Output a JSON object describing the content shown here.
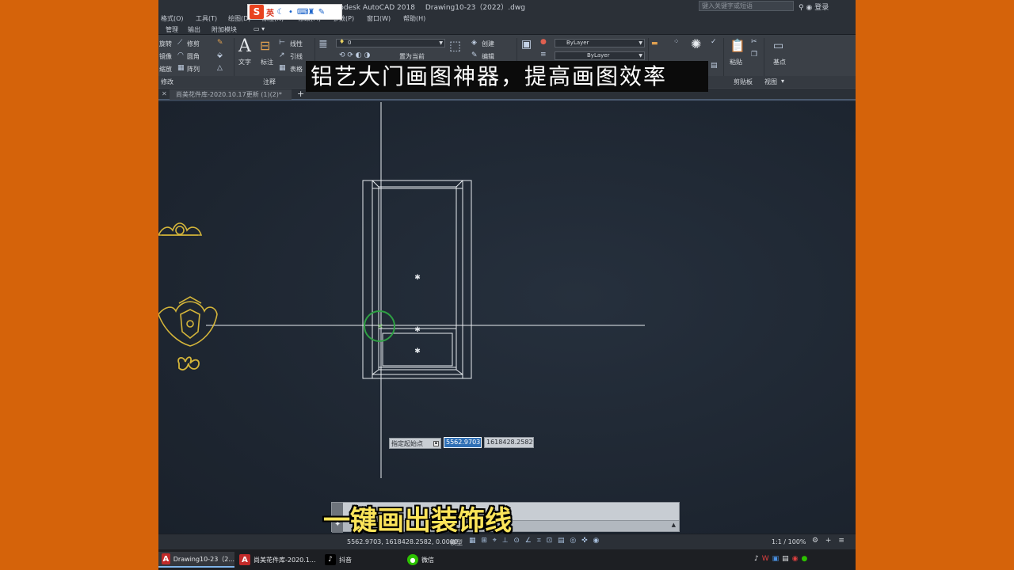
{
  "window": {
    "title_app": "Autodesk AutoCAD 2018",
    "title_file": "Drawing10-23（2022）.dwg",
    "search_placeholder": "键入关键字或短语",
    "user_label": "登录"
  },
  "ime": {
    "logo": "S",
    "mode": "英",
    "icons": [
      "moon-icon",
      "dot-icon",
      "keyboard-icon",
      "shirt-icon",
      "wrench-icon"
    ]
  },
  "menubar": {
    "items": [
      "格式(O)",
      "工具(T)",
      "绘图(D)",
      "标注(N)",
      "修改(M)",
      "参数(P)",
      "窗口(W)",
      "帮助(H)"
    ]
  },
  "ribbon_tabs": {
    "items": [
      "管理",
      "输出",
      "附加模块"
    ]
  },
  "ribbon": {
    "modify": {
      "rotate": "旋转",
      "trim": "修剪",
      "mirror": "镜像",
      "fillet": "圆角",
      "scale": "缩放",
      "array": "阵列",
      "panel": "修改"
    },
    "annotation": {
      "text": "文字",
      "dimension": "标注",
      "linear": "线性",
      "leader": "引线",
      "table": "表格",
      "panel": "注释"
    },
    "layers": {
      "current_layer": "0",
      "set_current": "置为当前"
    },
    "block": {
      "create": "创建",
      "edit": "编辑"
    },
    "properties": {
      "color": "ByLayer",
      "linetype": "ByLayer"
    },
    "clipboard": {
      "paste": "粘贴",
      "panel": "剪贴板"
    },
    "view": {
      "base": "基点",
      "panel": "视图"
    }
  },
  "file_tabs": {
    "active": "尚美花件库-2020.10.17更新 (1)(2)*"
  },
  "dynamic_input": {
    "prompt": "指定起始点",
    "x_value": "5562.9703",
    "y_value": "1618428.2582"
  },
  "status": {
    "coords": "5562.9703, 1618428.2582, 0.0000",
    "model": "模型",
    "scale": "1:1 / 100%"
  },
  "taskbar": {
    "items": [
      {
        "label": "Drawing10-23（2...",
        "icon": "autocad-icon"
      },
      {
        "label": "尚美花件库-2020.1...",
        "icon": "autocad-icon"
      },
      {
        "label": "抖音",
        "icon": "douyin-icon"
      },
      {
        "label": "微信",
        "icon": "wechat-icon"
      }
    ]
  },
  "overlay": {
    "headline": "铝艺大门画图神器，提高画图效率",
    "subtitle": "一键画出装饰线"
  },
  "colors": {
    "background": "#d5630a",
    "canvas": "#1f2733",
    "accent_blue": "#2f6fb5",
    "ornament": "#d4b53a",
    "subtitle": "#fbe45a"
  }
}
